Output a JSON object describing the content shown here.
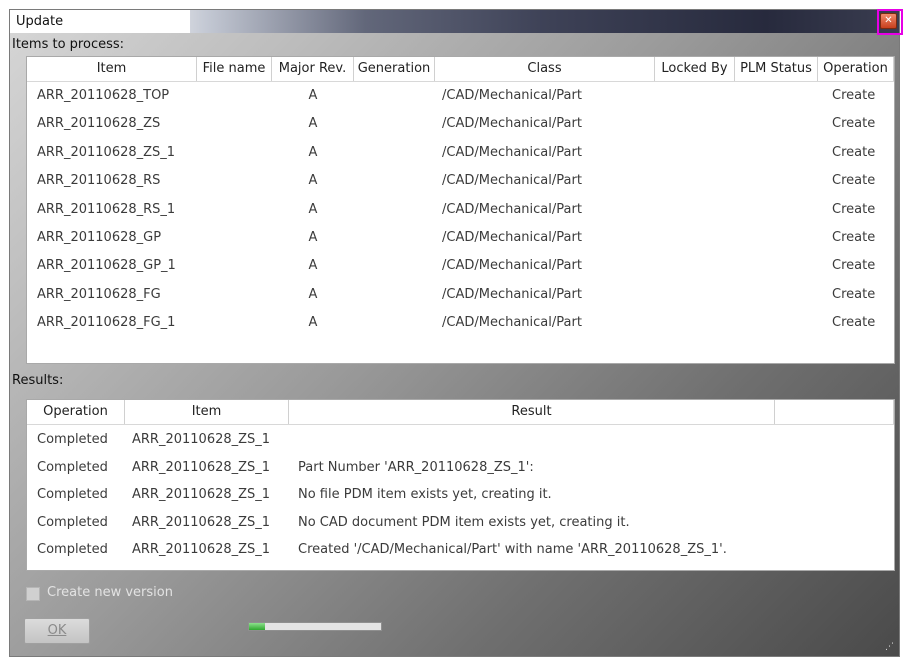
{
  "window": {
    "title": "Update",
    "close_glyph": "✕"
  },
  "items_section": {
    "label": "Items to process:",
    "columns": [
      "Item",
      "File name",
      "Major Rev.",
      "Generation",
      "Class",
      "Locked By",
      "PLM Status",
      "Operation"
    ],
    "rows": [
      [
        "ARR_20110628_TOP",
        "",
        "A",
        "",
        "/CAD/Mechanical/Part",
        "",
        "",
        "Create"
      ],
      [
        "ARR_20110628_ZS",
        "",
        "A",
        "",
        "/CAD/Mechanical/Part",
        "",
        "",
        "Create"
      ],
      [
        "ARR_20110628_ZS_1",
        "",
        "A",
        "",
        "/CAD/Mechanical/Part",
        "",
        "",
        "Create"
      ],
      [
        "ARR_20110628_RS",
        "",
        "A",
        "",
        "/CAD/Mechanical/Part",
        "",
        "",
        "Create"
      ],
      [
        "ARR_20110628_RS_1",
        "",
        "A",
        "",
        "/CAD/Mechanical/Part",
        "",
        "",
        "Create"
      ],
      [
        "ARR_20110628_GP",
        "",
        "A",
        "",
        "/CAD/Mechanical/Part",
        "",
        "",
        "Create"
      ],
      [
        "ARR_20110628_GP_1",
        "",
        "A",
        "",
        "/CAD/Mechanical/Part",
        "",
        "",
        "Create"
      ],
      [
        "ARR_20110628_FG",
        "",
        "A",
        "",
        "/CAD/Mechanical/Part",
        "",
        "",
        "Create"
      ],
      [
        "ARR_20110628_FG_1",
        "",
        "A",
        "",
        "/CAD/Mechanical/Part",
        "",
        "",
        "Create"
      ]
    ]
  },
  "results_section": {
    "label": "Results:",
    "columns": [
      "Operation",
      "Item",
      "Result"
    ],
    "rows": [
      [
        "Completed",
        "ARR_20110628_ZS_1",
        ""
      ],
      [
        "Completed",
        "ARR_20110628_ZS_1",
        "Part Number 'ARR_20110628_ZS_1':"
      ],
      [
        "Completed",
        "ARR_20110628_ZS_1",
        "No file PDM item exists yet, creating it."
      ],
      [
        "Completed",
        "ARR_20110628_ZS_1",
        "No CAD document PDM item exists yet, creating it."
      ],
      [
        "Completed",
        "ARR_20110628_ZS_1",
        "Created '/CAD/Mechanical/Part' with name 'ARR_20110628_ZS_1'."
      ]
    ]
  },
  "footer": {
    "create_new_version_label": "Create new version",
    "create_new_version_checked": false,
    "ok_label": "OK",
    "progress_fraction": 0.12
  },
  "colors": {
    "accent_focus": "#e600e6",
    "progress": "#2fa82f",
    "close": "#c8401e"
  }
}
